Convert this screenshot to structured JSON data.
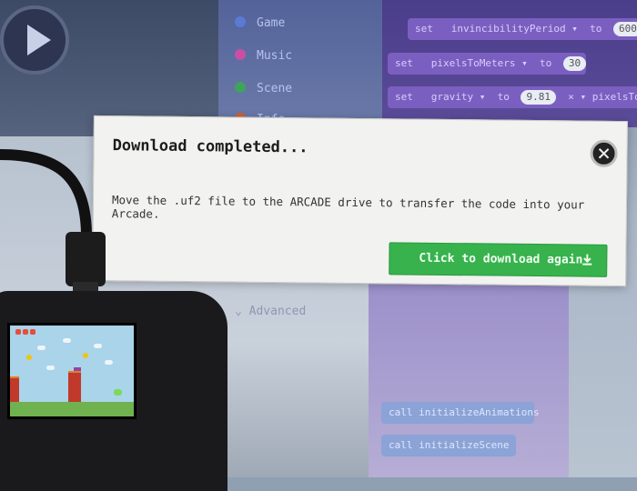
{
  "background": {
    "categories": [
      "Game",
      "Music",
      "Scene",
      "Info"
    ],
    "advanced_label": "Advanced",
    "code_blocks": [
      {
        "kw": "set",
        "var": "invincibilityPeriod ▾",
        "to": "to",
        "val": "600"
      },
      {
        "kw": "set",
        "var": "pixelsToMeters ▾",
        "to": "to",
        "val": "30"
      },
      {
        "kw": "set",
        "var": "gravity ▾",
        "to": "to",
        "val": "9.81",
        "extra": "× ▾  pixelsTo"
      }
    ],
    "lower_blocks": [
      "call initializeAnimations",
      "call initializeScene"
    ]
  },
  "dialog": {
    "title": "Download completed...",
    "message": "Move the .uf2 file to the ARCADE drive to transfer the code into your Arcade.",
    "button_label": "Click to download again",
    "button_color": "#37b24d"
  }
}
